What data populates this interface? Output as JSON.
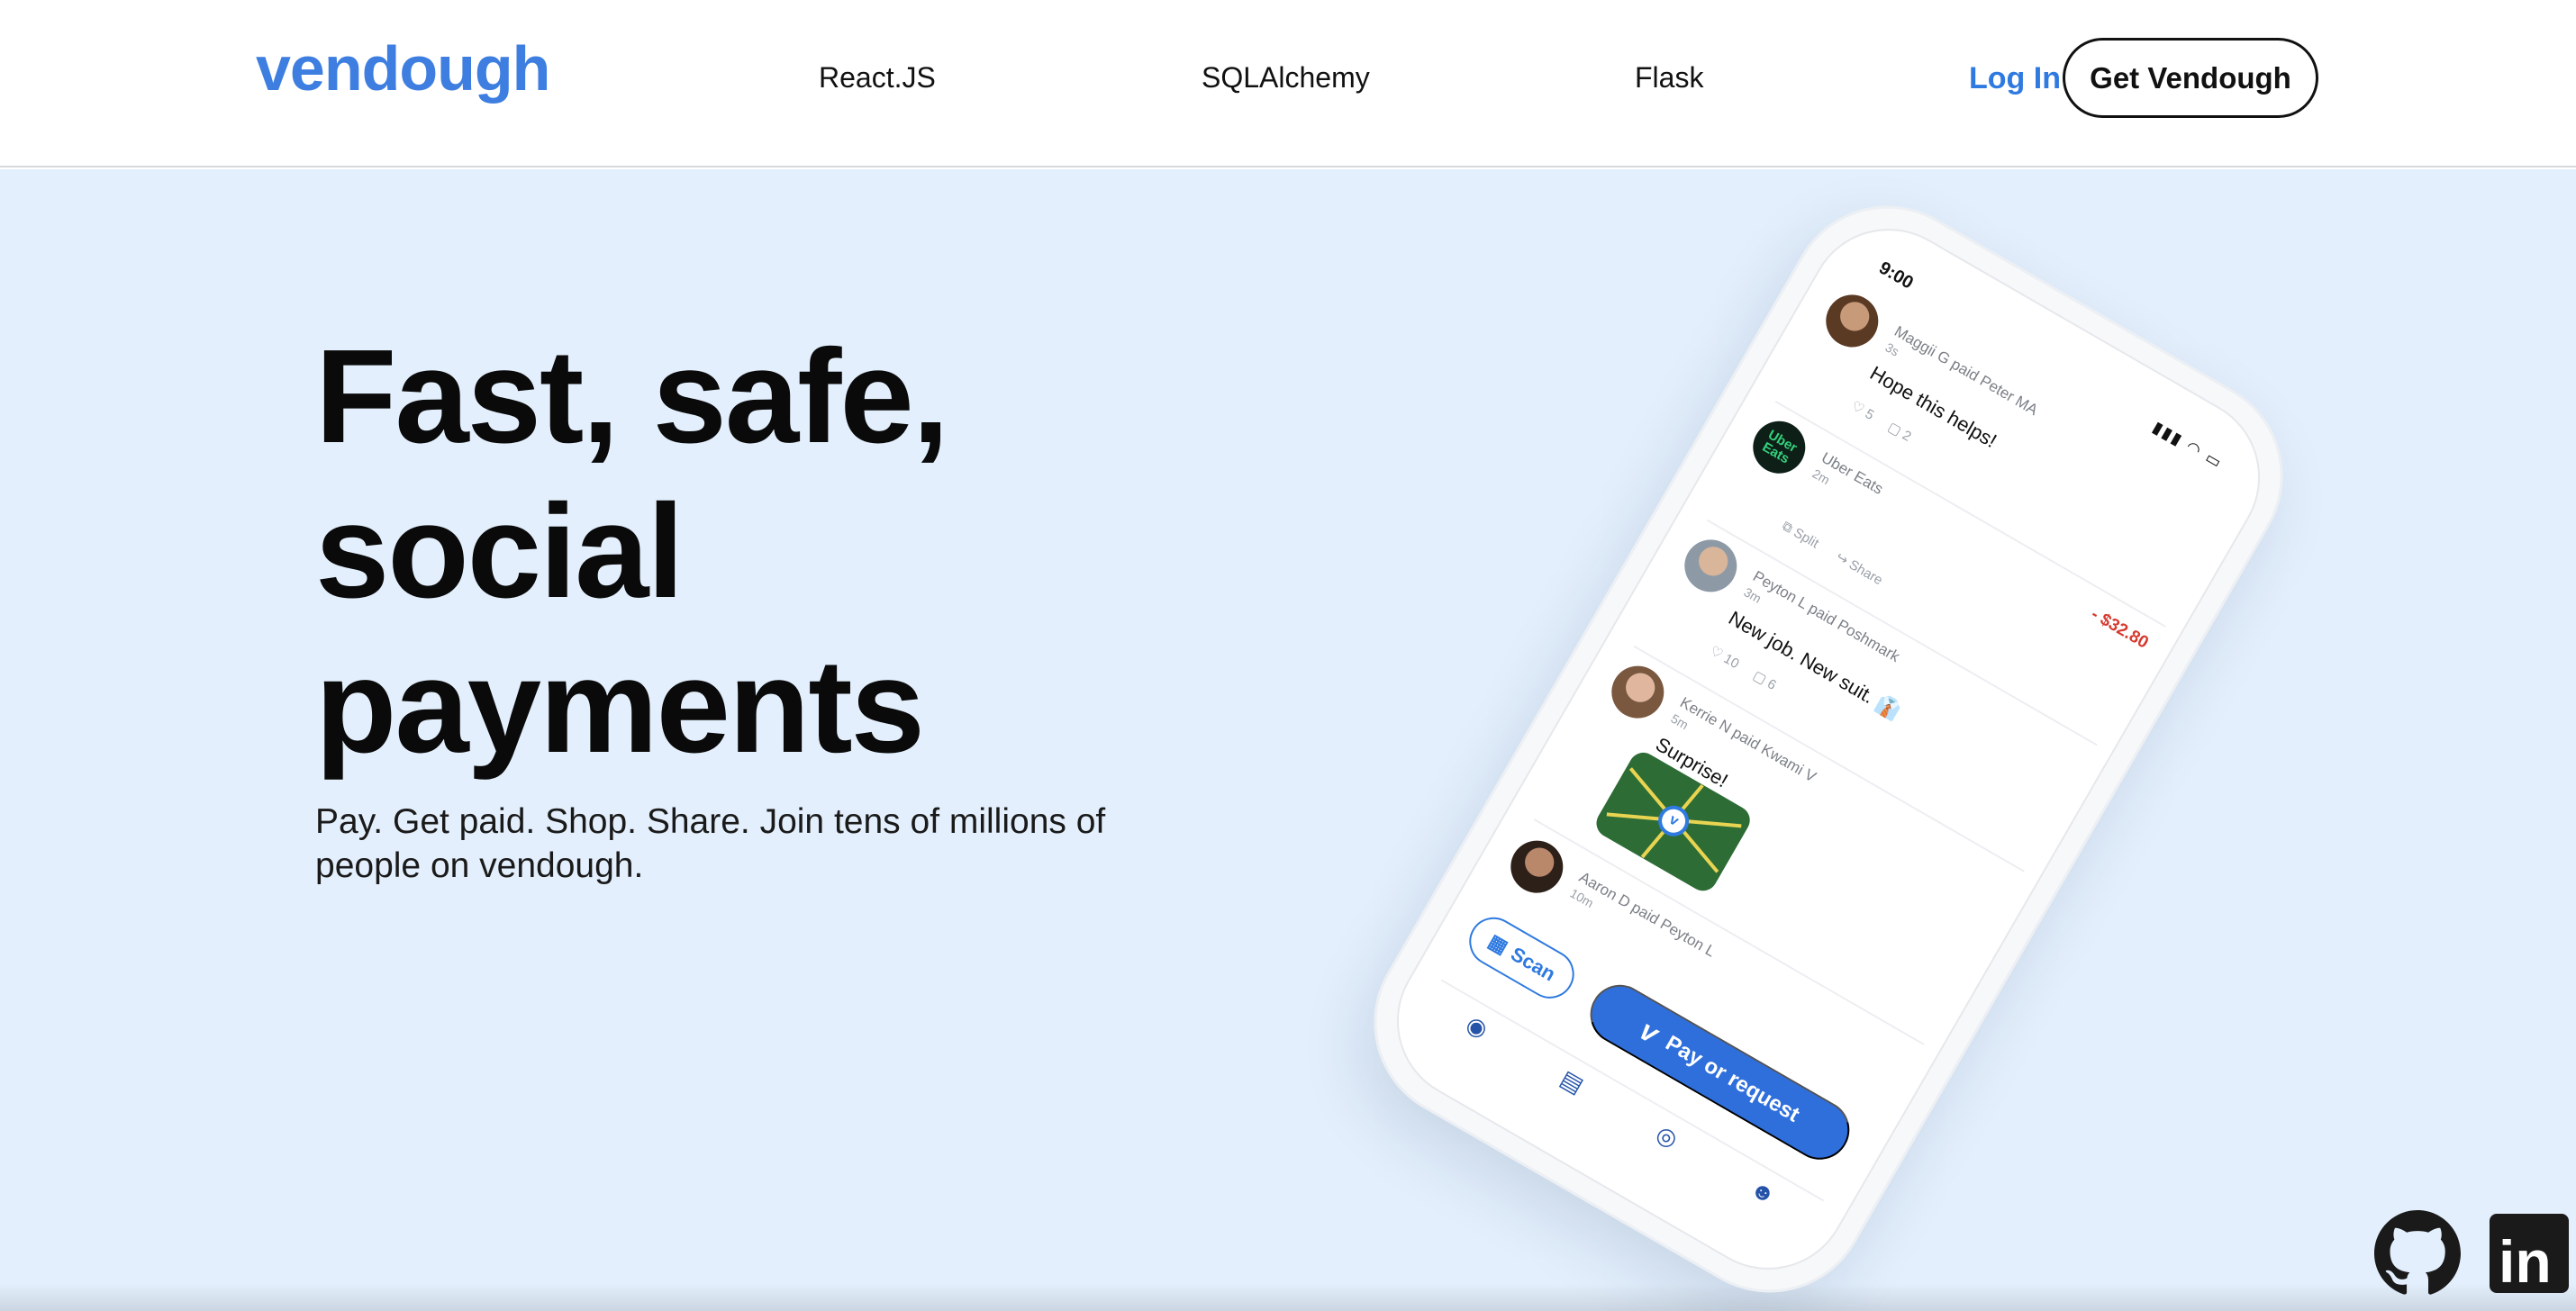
{
  "nav": {
    "logo": "vendough",
    "links": [
      "React.JS",
      "SQLAlchemy",
      "Flask"
    ],
    "login": "Log In",
    "cta": "Get Vendough"
  },
  "hero": {
    "headline": "Fast, safe, social payments",
    "subtext": "Pay. Get paid. Shop. Share. Join tens of millions of people on vendough."
  },
  "phone": {
    "time": "9:00",
    "feed": [
      {
        "title": "Maggii G paid Peter MA",
        "time": "3s",
        "note": "Hope this helps!",
        "likes": "5",
        "comments": "2"
      },
      {
        "title": "Uber Eats",
        "time": "2m",
        "avatar_text": "Uber Eats",
        "actions": [
          "Split",
          "Share"
        ],
        "amount": "- $32.80"
      },
      {
        "title": "Peyton L paid Poshmark",
        "time": "3m",
        "note": "New job. New suit. 👔",
        "likes": "10",
        "comments": "6"
      },
      {
        "title": "Kerrie N paid Kwami V",
        "time": "5m",
        "note": "Surprise!"
      },
      {
        "title": "Aaron D paid Peyton L",
        "time": "10m"
      }
    ],
    "scan_label": "Scan",
    "pay_label": "Pay or request"
  },
  "social": {
    "github": "github-icon",
    "linkedin": "in"
  },
  "colors": {
    "brand": "#3d7ee0",
    "hero_bg": "#e3effc",
    "pay_button": "#2f6fdc",
    "negative_amount": "#d63a2f"
  }
}
